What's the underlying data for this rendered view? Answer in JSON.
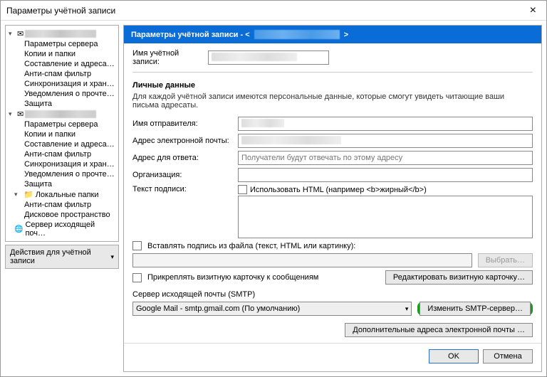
{
  "window": {
    "title": "Параметры учётной записи"
  },
  "sidebar": {
    "accounts": [
      {
        "items": [
          "Параметры сервера",
          "Копии и папки",
          "Составление и адресация",
          "Анти-спам фильтр",
          "Синхронизация и хранение",
          "Уведомления о прочтении",
          "Защита"
        ]
      },
      {
        "items": [
          "Параметры сервера",
          "Копии и папки",
          "Составление и адресация",
          "Анти-спам фильтр",
          "Синхронизация и хранение",
          "Уведомления о прочтении",
          "Защита"
        ]
      }
    ],
    "local_label": "Локальные папки",
    "local_items": [
      "Анти-спам фильтр",
      "Дисковое пространство"
    ],
    "outgoing_label": "Сервер исходящей поч…",
    "actions_label": "Действия для учётной записи"
  },
  "banner": {
    "prefix": "Параметры учётной записи - <",
    "suffix": ">"
  },
  "form": {
    "account_name_label": "Имя учётной записи:",
    "personal_section": "Личные данные",
    "personal_help": "Для каждой учётной записи имеются персональные данные, которые смогут увидеть читающие ваши письма адресаты.",
    "sender_name_label": "Имя отправителя:",
    "email_label": "Адрес электронной почты:",
    "reply_label": "Адрес для ответа:",
    "reply_placeholder": "Получатели будут отвечать по этому адресу",
    "org_label": "Организация:",
    "sig_label": "Текст подписи:",
    "use_html_label": "Использовать HTML (например <b>жирный</b>)",
    "insert_sig_label": "Вставлять подпись из файла (текст, HTML или картинку):",
    "choose_btn": "Выбрать…",
    "attach_vcard_label": "Прикреплять визитную карточку к сообщениям",
    "edit_vcard_btn": "Редактировать визитную карточку…",
    "smtp_label": "Сервер исходящей почты (SMTP)",
    "smtp_value": "Google Mail - smtp.gmail.com (По умолчанию)",
    "edit_smtp_btn": "Изменить SMTP-сервер…",
    "additional_btn": "Дополнительные адреса электронной почты …"
  },
  "footer": {
    "ok": "OK",
    "cancel": "Отмена"
  }
}
